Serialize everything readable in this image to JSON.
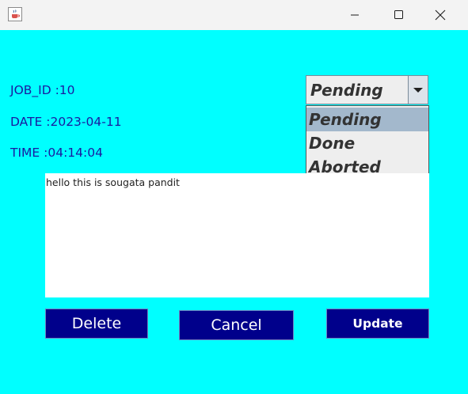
{
  "window": {
    "icon": "java-cup-icon",
    "controls": [
      "minimize-icon",
      "maximize-icon",
      "close-icon"
    ]
  },
  "form": {
    "job_id": "JOB_ID :10",
    "date": "DATE :2023-04-11",
    "time": "TIME :04:14:04"
  },
  "status": {
    "selected": "Pending",
    "options": [
      "Pending",
      "Done",
      "Aborted"
    ]
  },
  "description": "hello this is sougata pandit",
  "buttons": {
    "delete": "Delete",
    "cancel": "Cancel",
    "update": "Update"
  },
  "colors": {
    "background": "#00ffff",
    "button": "#00008b",
    "label_text": "#1a1aa0",
    "selection": "#a3b8cc"
  }
}
